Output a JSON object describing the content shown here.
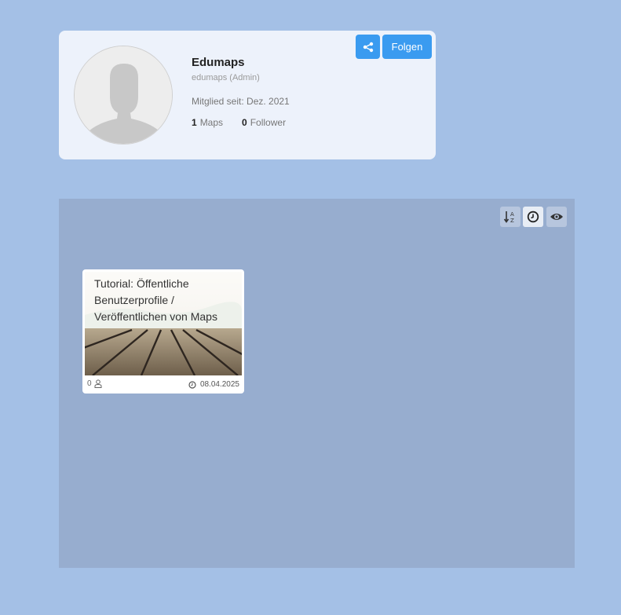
{
  "profile": {
    "name": "Edumaps",
    "subtitle": "edumaps (Admin)",
    "member_since": "Mitglied seit: Dez. 2021",
    "maps_count": "1",
    "maps_label": "Maps",
    "follower_count": "0",
    "follower_label": "Follower",
    "follow_label": "Folgen",
    "share_icon": "share-icon",
    "accent_color": "#3a9bf0"
  },
  "toolbar": {
    "sort_alpha_icon": "sort-alpha-icon",
    "sort_date_icon": "clock-icon",
    "views_icon": "eye-icon"
  },
  "maps": [
    {
      "title": "Tutorial: Öffentliche Benutzerprofile / Veröffentlichen von Maps",
      "users": "0",
      "date": "08.04.2025"
    }
  ]
}
